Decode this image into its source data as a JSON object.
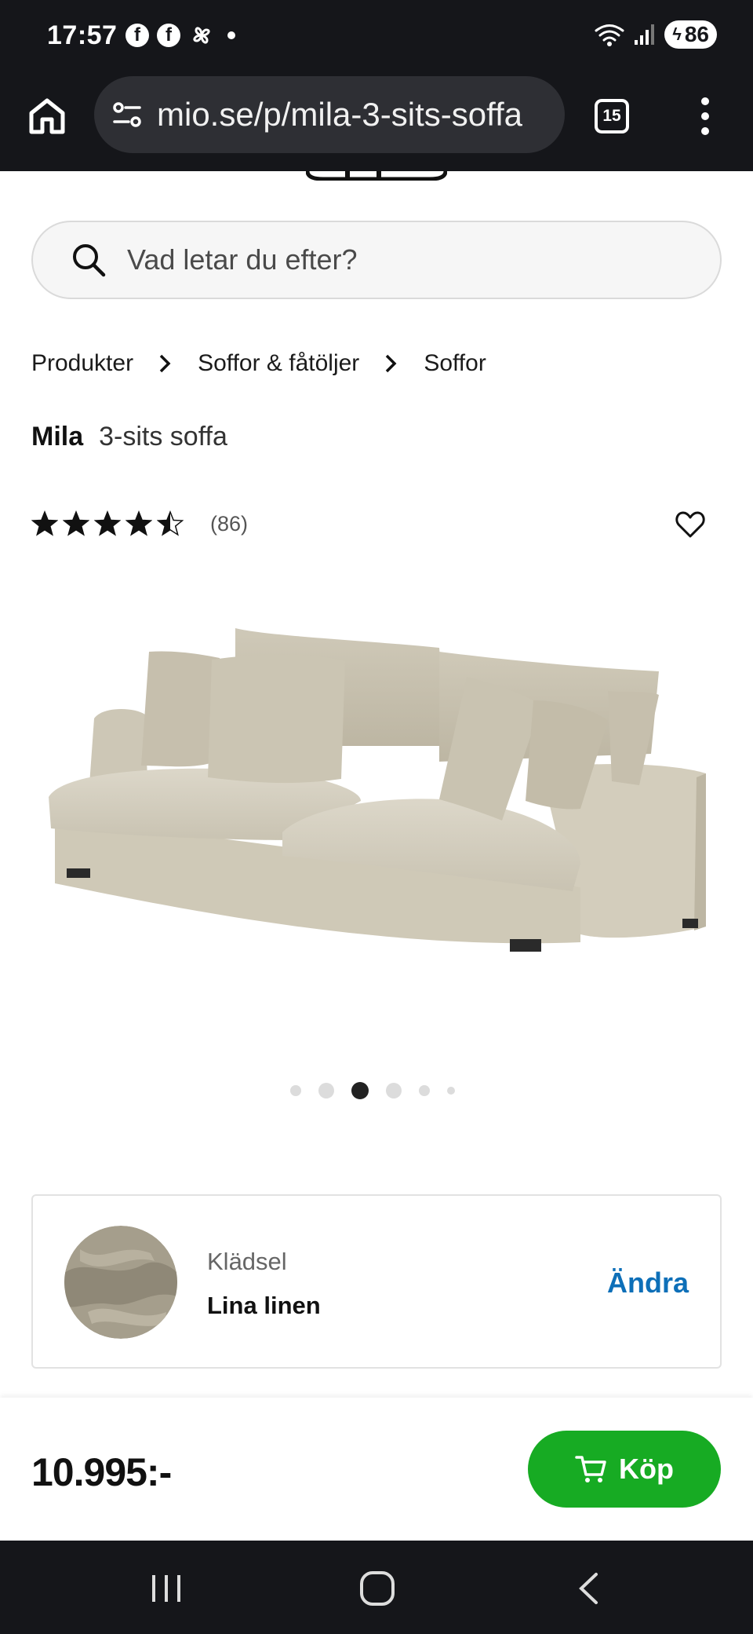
{
  "status_bar": {
    "time": "17:57",
    "battery": "86",
    "icons": [
      "facebook-icon",
      "facebook-icon",
      "pinwheel-icon",
      "notification-dot",
      "wifi-icon",
      "signal-icon",
      "battery-icon"
    ]
  },
  "browser": {
    "url": "mio.se/p/mila-3-sits-soffa",
    "tab_count": "15"
  },
  "search": {
    "placeholder": "Vad letar du efter?"
  },
  "breadcrumb": [
    "Produkter",
    "Soffor & fåtöljer",
    "Soffor"
  ],
  "product": {
    "name": "Mila",
    "subtitle": "3-sits soffa",
    "rating": 4.5,
    "review_count": "(86)",
    "price": "10.995:-"
  },
  "gallery": {
    "total": 6,
    "active_index": 2
  },
  "option": {
    "label": "Klädsel",
    "value": "Lina linen",
    "change_label": "Ändra"
  },
  "buy": {
    "label": "Köp"
  },
  "colors": {
    "buy_button": "#17ab23",
    "change_link": "#0d6fb8",
    "system_bars": "#15161a",
    "sofa_fabric": "#d8d3c4"
  }
}
